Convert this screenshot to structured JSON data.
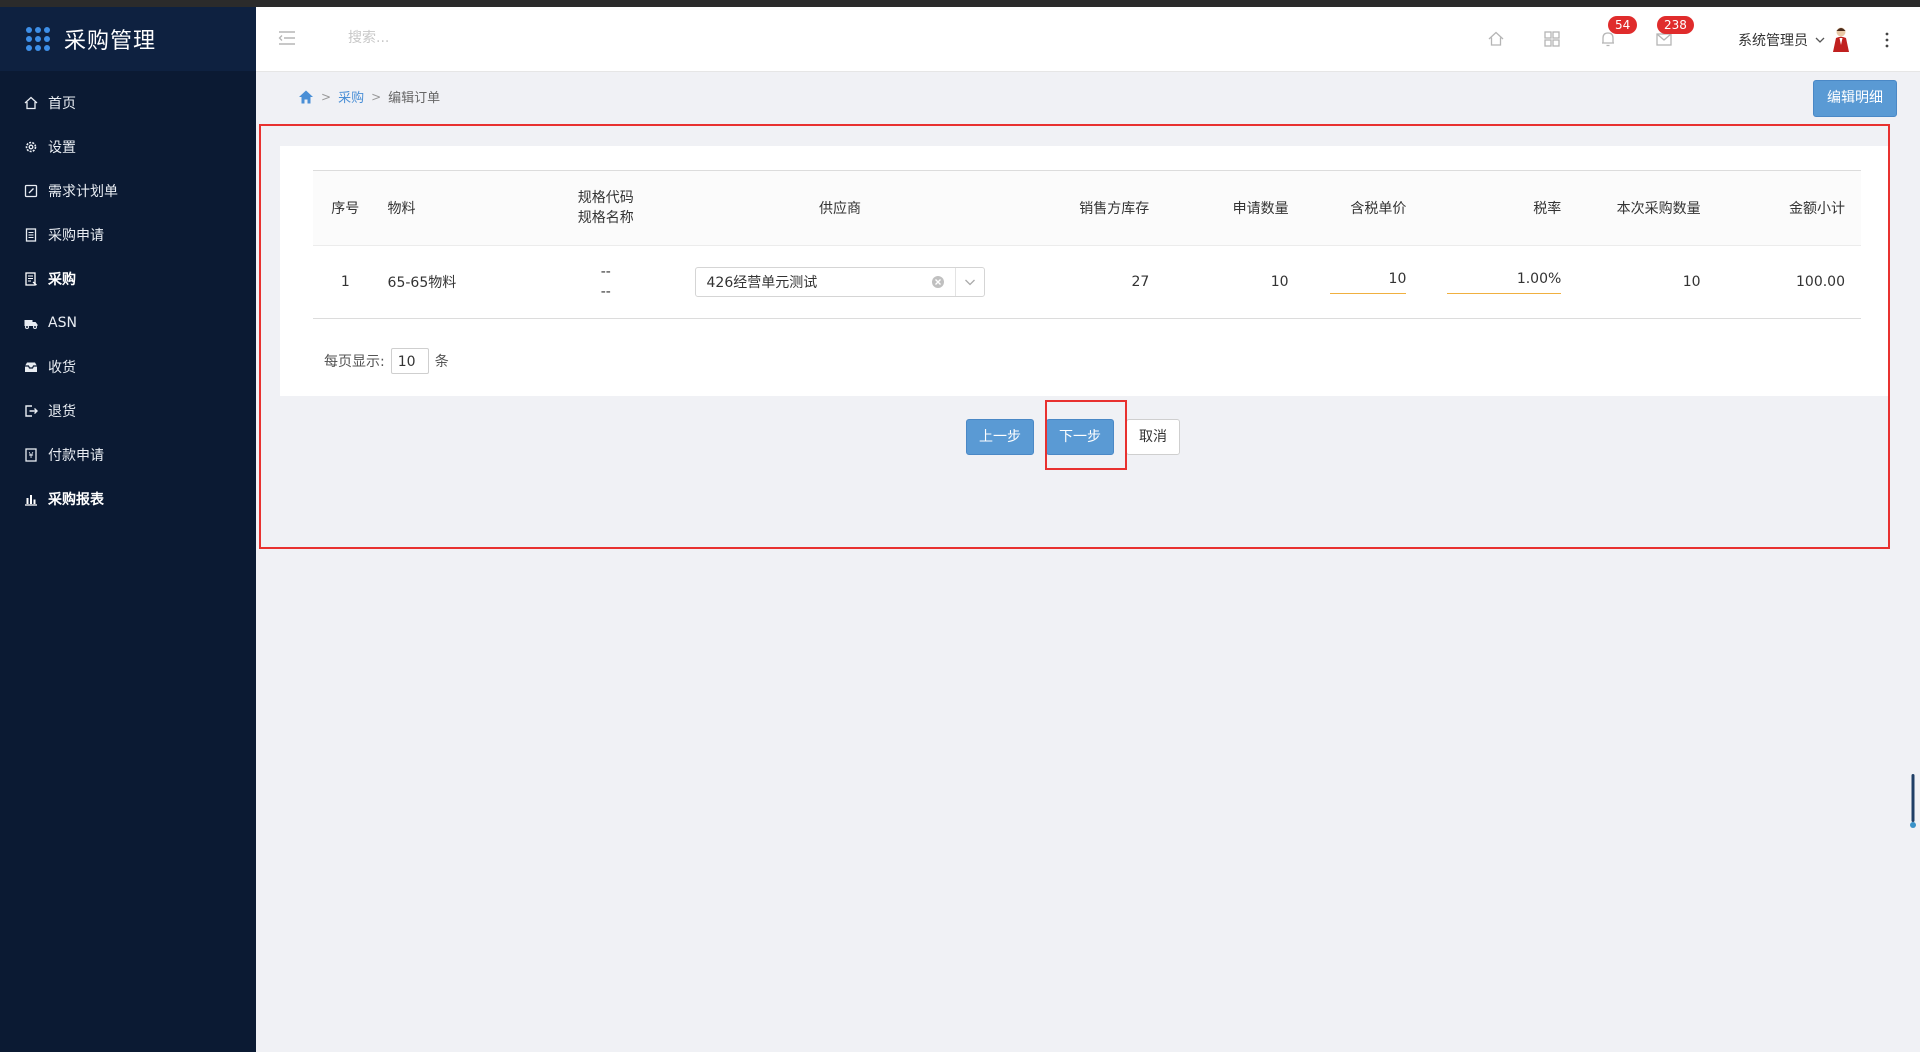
{
  "app": {
    "title": "采购管理"
  },
  "sidebar": {
    "items": [
      {
        "label": "首页",
        "icon": "home-icon"
      },
      {
        "label": "设置",
        "icon": "gear-icon"
      },
      {
        "label": "需求计划单",
        "icon": "edit-doc-icon"
      },
      {
        "label": "采购申请",
        "icon": "doc-icon"
      },
      {
        "label": "采购",
        "icon": "list-doc-icon",
        "active": true
      },
      {
        "label": "ASN",
        "icon": "truck-icon"
      },
      {
        "label": "收货",
        "icon": "inbox-icon"
      },
      {
        "label": "退货",
        "icon": "return-icon"
      },
      {
        "label": "付款申请",
        "icon": "payment-icon"
      },
      {
        "label": "采购报表",
        "icon": "bar-chart-icon"
      }
    ]
  },
  "header": {
    "search_placeholder": "搜索...",
    "notifications_count": "54",
    "messages_count": "238",
    "user_name": "系统管理员"
  },
  "breadcrumb": {
    "item1": "采购",
    "item2": "编辑订单"
  },
  "toolbar": {
    "edit_detail_label": "编辑明细"
  },
  "table": {
    "headers": {
      "no": "序号",
      "material": "物料",
      "spec_code": "规格代码",
      "spec_name": "规格名称",
      "supplier": "供应商",
      "stock": "销售方库存",
      "request_qty": "申请数量",
      "unit_price": "含税单价",
      "tax_rate": "税率",
      "purchase_qty": "本次采购数量",
      "subtotal": "金额小计"
    },
    "rows": [
      {
        "no": "1",
        "material": "65-65物料",
        "spec_code": "--",
        "spec_name": "--",
        "supplier": "426经营单元测试",
        "stock": "27",
        "request_qty": "10",
        "unit_price": "10",
        "tax_rate": "1.00%",
        "purchase_qty": "10",
        "subtotal": "100.00"
      }
    ]
  },
  "pager": {
    "label": "每页显示:",
    "value": "10",
    "unit": "条"
  },
  "actions": {
    "prev": "上一步",
    "next": "下一步",
    "cancel": "取消"
  },
  "colors": {
    "sidebar_bg": "#0b1a33",
    "accent": "#5a9ad4",
    "highlight": "#e8312f",
    "badge": "#e02c2c"
  }
}
